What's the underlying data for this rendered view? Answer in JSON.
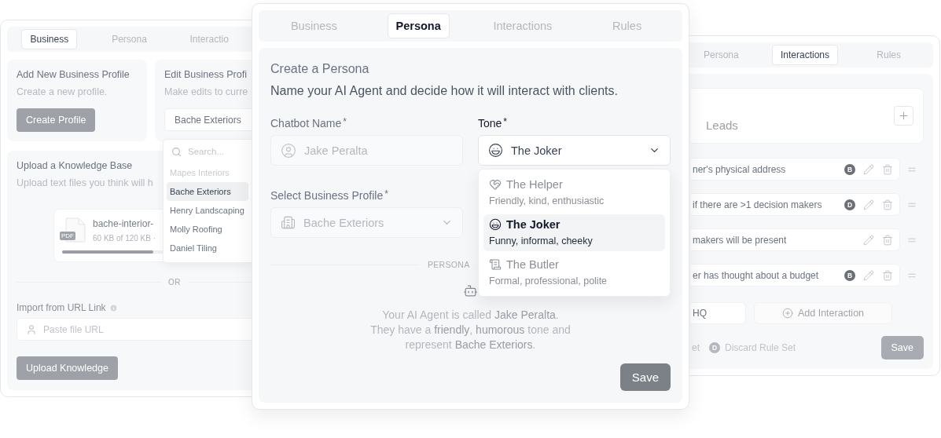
{
  "business_window": {
    "tabs": [
      {
        "label": "Business",
        "selected": true
      },
      {
        "label": "Persona",
        "selected": false
      },
      {
        "label": "Interactio",
        "selected": false
      }
    ],
    "add_profile": {
      "title": "Add New Business Profile",
      "description": "Create a new profile.",
      "button": "Create Profile"
    },
    "edit_profile": {
      "title": "Edit Business Profi",
      "description": "Make edits to curre",
      "value": "Bache Exteriors",
      "search_placeholder": "Search...",
      "options": [
        {
          "label": "Mapes Interiors",
          "selected": false,
          "disabled": true
        },
        {
          "label": "Bache Exteriors",
          "selected": true,
          "disabled": false
        },
        {
          "label": "Henry Landscaping",
          "selected": false,
          "disabled": false
        },
        {
          "label": "Molly Roofing",
          "selected": false,
          "disabled": false
        },
        {
          "label": "Daniel Tiling",
          "selected": false,
          "disabled": false
        }
      ]
    },
    "knowledge": {
      "title": "Upload a Knowledge Base",
      "description": "Upload text files you think will h",
      "file": {
        "name": "bache-interior-",
        "badge": "PDF",
        "size": "60 KB of 120 KB ·",
        "level": 0.5
      },
      "divider": "OR",
      "url_label": "Import from URL Link",
      "url_placeholder": "Paste file URL",
      "button": "Upload Knowledge"
    }
  },
  "persona_window": {
    "tabs": [
      {
        "label": "Business",
        "selected": false
      },
      {
        "label": "Persona",
        "selected": true
      },
      {
        "label": "Interactions",
        "selected": false
      },
      {
        "label": "Rules",
        "selected": false
      }
    ],
    "title": "Create a Persona",
    "subtitle": "Name your AI Agent and decide how it will interact with clients.",
    "chatbot_name": {
      "label": "Chatbot Name$^{*}$",
      "placeholder": "Jake Peralta",
      "focused": false
    },
    "tone": {
      "label": "Tone$^{*}$",
      "value": "The Joker",
      "focused": true,
      "options": [
        {
          "kind": "helper",
          "label": "The Helper",
          "description": "Friendly, kind, enthusiastic",
          "selected": false
        },
        {
          "kind": "joker",
          "label": "The Joker",
          "description": "Funny, informal, cheeky",
          "selected": true
        },
        {
          "kind": "butler",
          "label": "The Butler",
          "description": "Formal, professional, polite",
          "selected": false
        }
      ]
    },
    "business_profile": {
      "label": "Select Business Profile$^{*}$",
      "value": "Bache Exteriors",
      "focused": false
    },
    "divider": "PERSONA",
    "preview": "Your AI Agent is called **Jake Peralta**.\nThey have a **friendly**, **humorous** tone and\nrepresent **Bache Exteriors**.",
    "save": "Save"
  },
  "interactions_window": {
    "tabs": [
      {
        "label": "Persona",
        "selected": false
      },
      {
        "label": "Interactions",
        "selected": true
      },
      {
        "label": "Rules",
        "selected": false
      }
    ],
    "list_title": "Leads",
    "rows": [
      {
        "text": "ner's physical address",
        "badge": "B"
      },
      {
        "text": "if there are >1 decision makers",
        "badge": "D"
      },
      {
        "text": "makers will be present"
      },
      {
        "text": "er has thought about a budget",
        "badge": "B"
      }
    ],
    "hq_value": "HQ",
    "add_button": "Add Interaction",
    "footer": {
      "partial": "et",
      "badge": "D",
      "discard": "Discard Rule Set",
      "save": "Save"
    }
  }
}
